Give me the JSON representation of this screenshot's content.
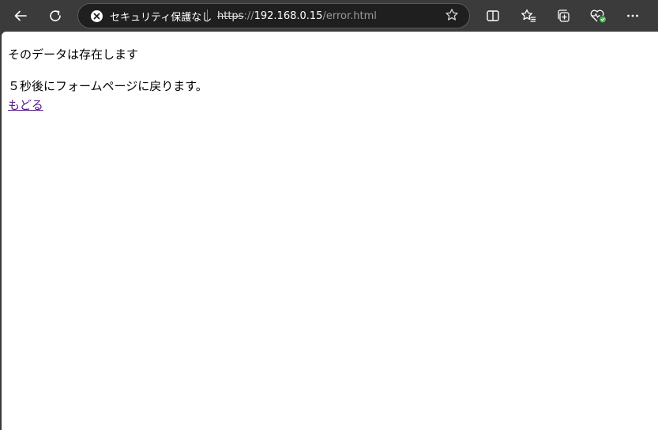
{
  "browser": {
    "security_label": "セキュリティ保護なし",
    "url": {
      "scheme": "https",
      "separator": "://",
      "host": "192.168.0.15",
      "path": "/error.html"
    },
    "icons": [
      "back-arrow-icon",
      "refresh-icon",
      "not-secure-icon",
      "favorite-star-icon",
      "split-screen-icon",
      "favorites-icon",
      "collections-icon",
      "browser-essentials-icon",
      "more-menu-icon"
    ],
    "colors": {
      "toolbar": "#3b3b3b",
      "address_bar": "#1f1f1f",
      "essentials_badge": "#3fb950"
    }
  },
  "page": {
    "message": "そのデータは存在します",
    "redirect_notice": "５秒後にフォームページに戻ります。",
    "back_link": "もどる",
    "link_color": "#551a8b"
  }
}
